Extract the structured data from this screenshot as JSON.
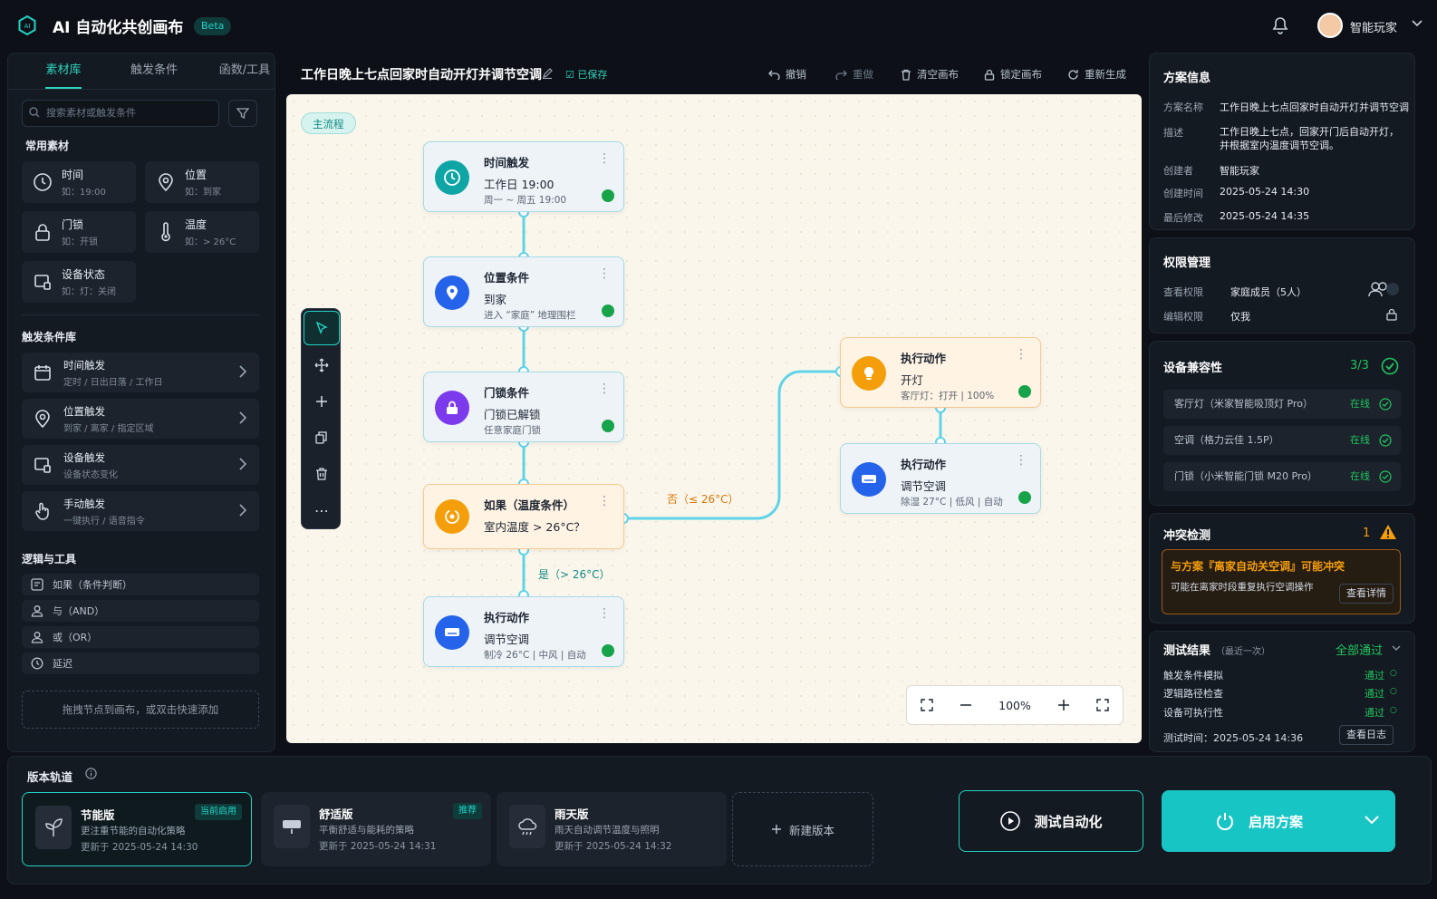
{
  "header": {
    "app_title": "AI 自动化共创画布",
    "beta": "Beta",
    "user": "智能玩家"
  },
  "left": {
    "tabs": [
      "素材库",
      "触发条件",
      "函数/工具"
    ],
    "search_placeholder": "搜索素材或触发条件",
    "common_title": "常用素材",
    "materials": [
      {
        "name": "时间",
        "hint": "如：19:00",
        "icon": "clock-icon"
      },
      {
        "name": "位置",
        "hint": "如：到家",
        "icon": "location-icon"
      },
      {
        "name": "门锁",
        "hint": "如：开锁",
        "icon": "lock-icon"
      },
      {
        "name": "温度",
        "hint": "如：> 26°C",
        "icon": "thermometer-icon"
      },
      {
        "name": "设备状态",
        "hint": "如：灯：关闭",
        "icon": "device-icon"
      }
    ],
    "trigger_title": "触发条件库",
    "triggers": [
      {
        "name": "时间触发",
        "desc": "定时 / 日出日落 / 工作日",
        "icon": "calendar-icon"
      },
      {
        "name": "位置触发",
        "desc": "到家 / 离家 / 指定区域",
        "icon": "location-icon"
      },
      {
        "name": "设备触发",
        "desc": "设备状态变化",
        "icon": "device-icon"
      },
      {
        "name": "手动触发",
        "desc": "一键执行 / 语音指令",
        "icon": "hand-icon"
      }
    ],
    "logic_title": "逻辑与工具",
    "logic": [
      "如果（条件判断）",
      "与（AND）",
      "或（OR）",
      "延迟"
    ],
    "dropzone": "拖拽节点到画布，或双击快速添加"
  },
  "center": {
    "title": "工作日晚上七点回家时自动开灯并调节空调",
    "saved": "已保存",
    "toolbar": [
      "撤销",
      "重做",
      "清空画布",
      "锁定画布",
      "重新生成"
    ],
    "flow_label": "主流程",
    "nodes": [
      {
        "title": "时间触发",
        "value": "工作日 19:00",
        "desc": "周一 ~ 周五 19:00",
        "icon": "clock-icon",
        "color": "#0ea5a4"
      },
      {
        "title": "位置条件",
        "value": "到家",
        "desc": "进入 “家庭” 地理围栏",
        "icon": "location-icon",
        "color": "#2563eb"
      },
      {
        "title": "门锁条件",
        "value": "门锁已解锁",
        "desc": "任意家庭门锁",
        "icon": "lock-icon",
        "color": "#7c3aed"
      },
      {
        "title": "如果（温度条件）",
        "value": "室内温度 > 26°C？",
        "desc": "",
        "icon": "condition-icon",
        "color": "#f59e0b"
      },
      {
        "title": "执行动作",
        "value": "调节空调",
        "desc": "制冷 26°C | 中风 | 自动",
        "icon": "ac-icon",
        "color": "#2563eb"
      },
      {
        "title": "执行动作",
        "value": "开灯",
        "desc": "客厅灯：打开 | 100%",
        "icon": "bulb-icon",
        "color": "#f59e0b"
      },
      {
        "title": "执行动作",
        "value": "调节空调",
        "desc": "除湿 27°C | 低风 | 自动",
        "icon": "ac-icon",
        "color": "#2563eb"
      }
    ],
    "edge_no": "否（≤ 26°C）",
    "edge_yes": "是（> 26°C）",
    "zoom": "100%"
  },
  "right": {
    "info_title": "方案信息",
    "info": [
      {
        "k": "方案名称",
        "v": "工作日晚上七点回家时自动开灯并调节空调"
      },
      {
        "k": "描述",
        "v": "工作日晚上七点，回家开门后自动开灯，并根据室内温度调节空调。"
      },
      {
        "k": "创建者",
        "v": "智能玩家"
      },
      {
        "k": "创建时间",
        "v": "2025-05-24 14:30"
      },
      {
        "k": "最后修改",
        "v": "2025-05-24 14:35"
      }
    ],
    "perm_title": "权限管理",
    "perm": [
      {
        "k": "查看权限",
        "v": "家庭成员（5人）"
      },
      {
        "k": "编辑权限",
        "v": "仅我"
      }
    ],
    "compat_title": "设备兼容性",
    "compat_count": "3/3",
    "devices": [
      {
        "name": "客厅灯（米家智能吸顶灯 Pro）",
        "status": "在线"
      },
      {
        "name": "空调（格力云佳 1.5P）",
        "status": "在线"
      },
      {
        "name": "门锁（小米智能门锁 M20 Pro）",
        "status": "在线"
      }
    ],
    "conflict_title": "冲突检测",
    "conflict_count": "1",
    "conflict_head": "与方案『离家自动关空调』可能冲突",
    "conflict_desc": "可能在离家时段重复执行空调操作",
    "conflict_btn": "查看详情",
    "test_title": "测试结果",
    "test_sub": "（最近一次）",
    "test_all": "全部通过",
    "tests": [
      {
        "k": "触发条件模拟",
        "v": "通过"
      },
      {
        "k": "逻辑路径检查",
        "v": "通过"
      },
      {
        "k": "设备可执行性",
        "v": "通过"
      }
    ],
    "test_time": "测试时间：2025-05-24 14:36",
    "log_btn": "查看日志"
  },
  "bottom": {
    "title": "版本轨道",
    "versions": [
      {
        "name": "节能版",
        "desc": "更注重节能的自动化策略",
        "updated": "更新于 2025-05-24 14:30",
        "badge": "当前启用"
      },
      {
        "name": "舒适版",
        "desc": "平衡舒适与能耗的策略",
        "updated": "更新于 2025-05-24 14:31",
        "badge": "推荐"
      },
      {
        "name": "雨天版",
        "desc": "雨天自动调节温度与照明",
        "updated": "更新于 2025-05-24 14:32",
        "badge": ""
      }
    ],
    "new_version": "新建版本",
    "test_btn": "测试自动化",
    "enable_btn": "启用方案"
  }
}
